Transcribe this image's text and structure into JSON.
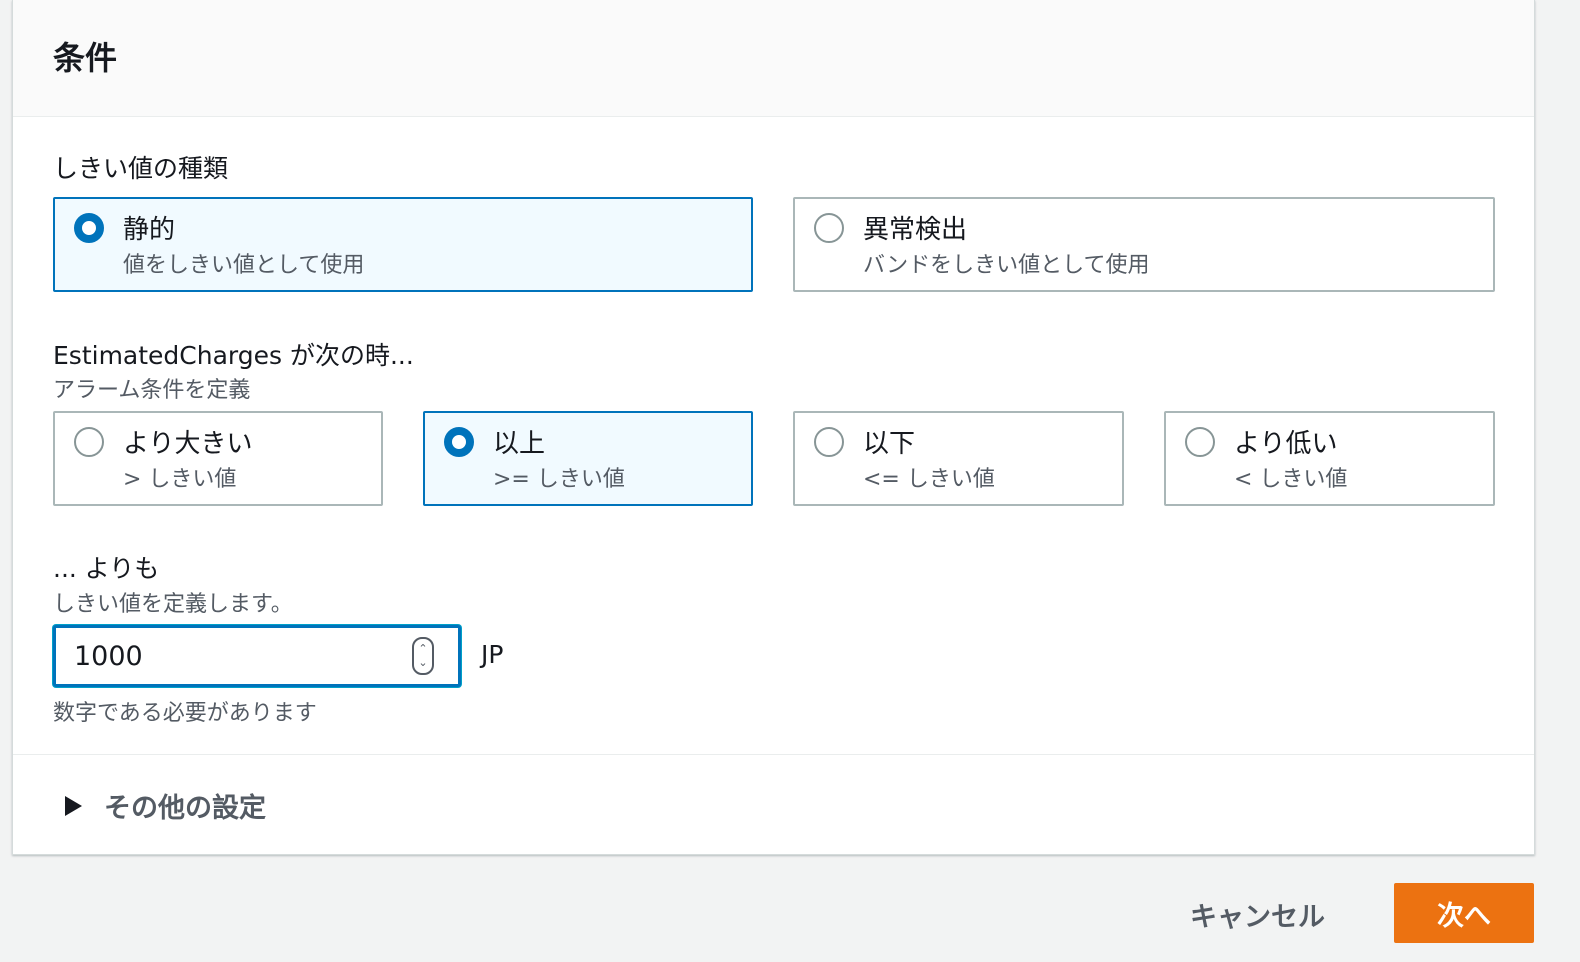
{
  "panel": {
    "title": "条件"
  },
  "threshold_type": {
    "label": "しきい値の種類",
    "options": [
      {
        "title": "静的",
        "desc": "値をしきい値として使用",
        "selected": true
      },
      {
        "title": "異常検出",
        "desc": "バンドをしきい値として使用",
        "selected": false
      }
    ]
  },
  "condition": {
    "label": "EstimatedCharges が次の時...",
    "desc": "アラーム条件を定義",
    "options": [
      {
        "title": "より大きい",
        "desc": "> しきい値",
        "selected": false
      },
      {
        "title": "以上",
        "desc": ">= しきい値",
        "selected": true
      },
      {
        "title": "以下",
        "desc": "<= しきい値",
        "selected": false
      },
      {
        "title": "より低い",
        "desc": "< しきい値",
        "selected": false
      }
    ]
  },
  "threshold_value": {
    "label": "... よりも",
    "desc": "しきい値を定義します。",
    "value": "1000",
    "unit": "JP",
    "hint": "数字である必要があります"
  },
  "additional": {
    "label": "その他の設定"
  },
  "footer": {
    "cancel_label": "キャンセル",
    "next_label": "次へ"
  },
  "colors": {
    "accent": "#0073bb",
    "primary_button": "#ec7211"
  }
}
